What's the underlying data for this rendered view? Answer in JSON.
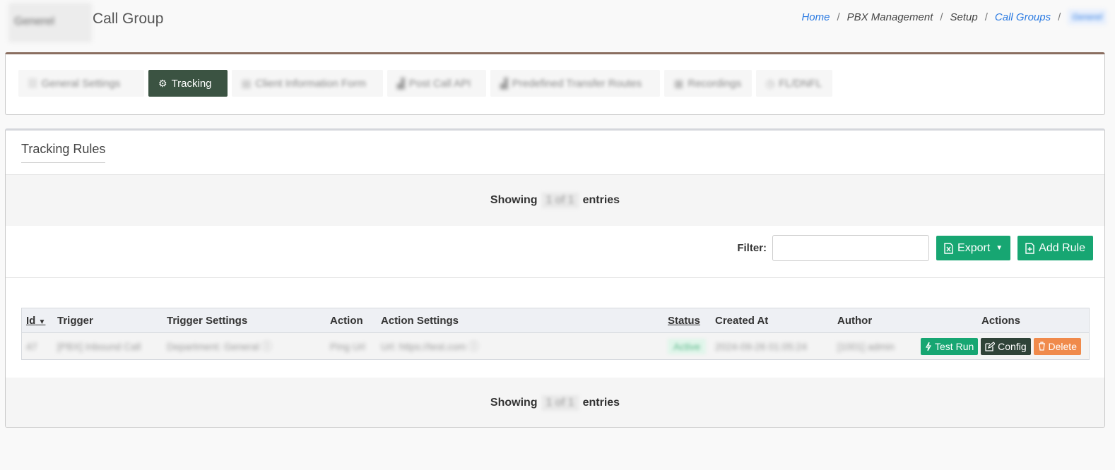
{
  "header": {
    "name_chip": "Generel",
    "title": "Call Group",
    "breadcrumb": {
      "home": "Home",
      "pbx": "PBX Management",
      "setup": "Setup",
      "call_groups": "Call Groups",
      "current": "Generel",
      "separator": "/"
    }
  },
  "tabs": [
    {
      "label": "General Settings",
      "icon": "sliders-icon",
      "glyph": "☷"
    },
    {
      "label": "Tracking",
      "icon": "gears-icon",
      "glyph": "⚙"
    },
    {
      "label": "Client Information Form",
      "icon": "form-icon",
      "glyph": "▤"
    },
    {
      "label": "Post Call API",
      "icon": "chart-icon",
      "glyph": "▟"
    },
    {
      "label": "Predefined Transfer Routes",
      "icon": "chart-icon",
      "glyph": "▟"
    },
    {
      "label": "Recordings",
      "icon": "list-icon",
      "glyph": "▦"
    },
    {
      "label": "FL/DNFL",
      "icon": "clock-icon",
      "glyph": "◷"
    }
  ],
  "card": {
    "title": "Tracking Rules",
    "showing_prefix": "Showing",
    "showing_count": "1 of 1",
    "showing_suffix": "entries"
  },
  "toolbar": {
    "filter_label": "Filter:",
    "filter_value": "",
    "export_label": "Export",
    "add_rule_label": "Add Rule"
  },
  "table": {
    "columns": [
      "Id",
      "Trigger",
      "Trigger Settings",
      "Action",
      "Action Settings",
      "Status",
      "Created At",
      "Author",
      "Actions"
    ],
    "rows": [
      {
        "id": "47",
        "trigger": "[PBX] Inbound Call",
        "trigger_settings": "Department: General",
        "action": "Ping Url",
        "action_settings": "Url: https://test.com",
        "status": "Active",
        "created_at": "2024-09-26 01:05:24",
        "author": "[1001] admin",
        "actions": {
          "test": "Test Run",
          "config": "Config",
          "delete": "Delete"
        }
      }
    ]
  },
  "colors": {
    "active_tab": "#3b5342",
    "accent_green": "#17a672",
    "config_dark": "#2f4338",
    "delete_orange": "#f08a4b",
    "link_blue": "#2a7ae2",
    "card_border_top": "#8a6e60"
  }
}
